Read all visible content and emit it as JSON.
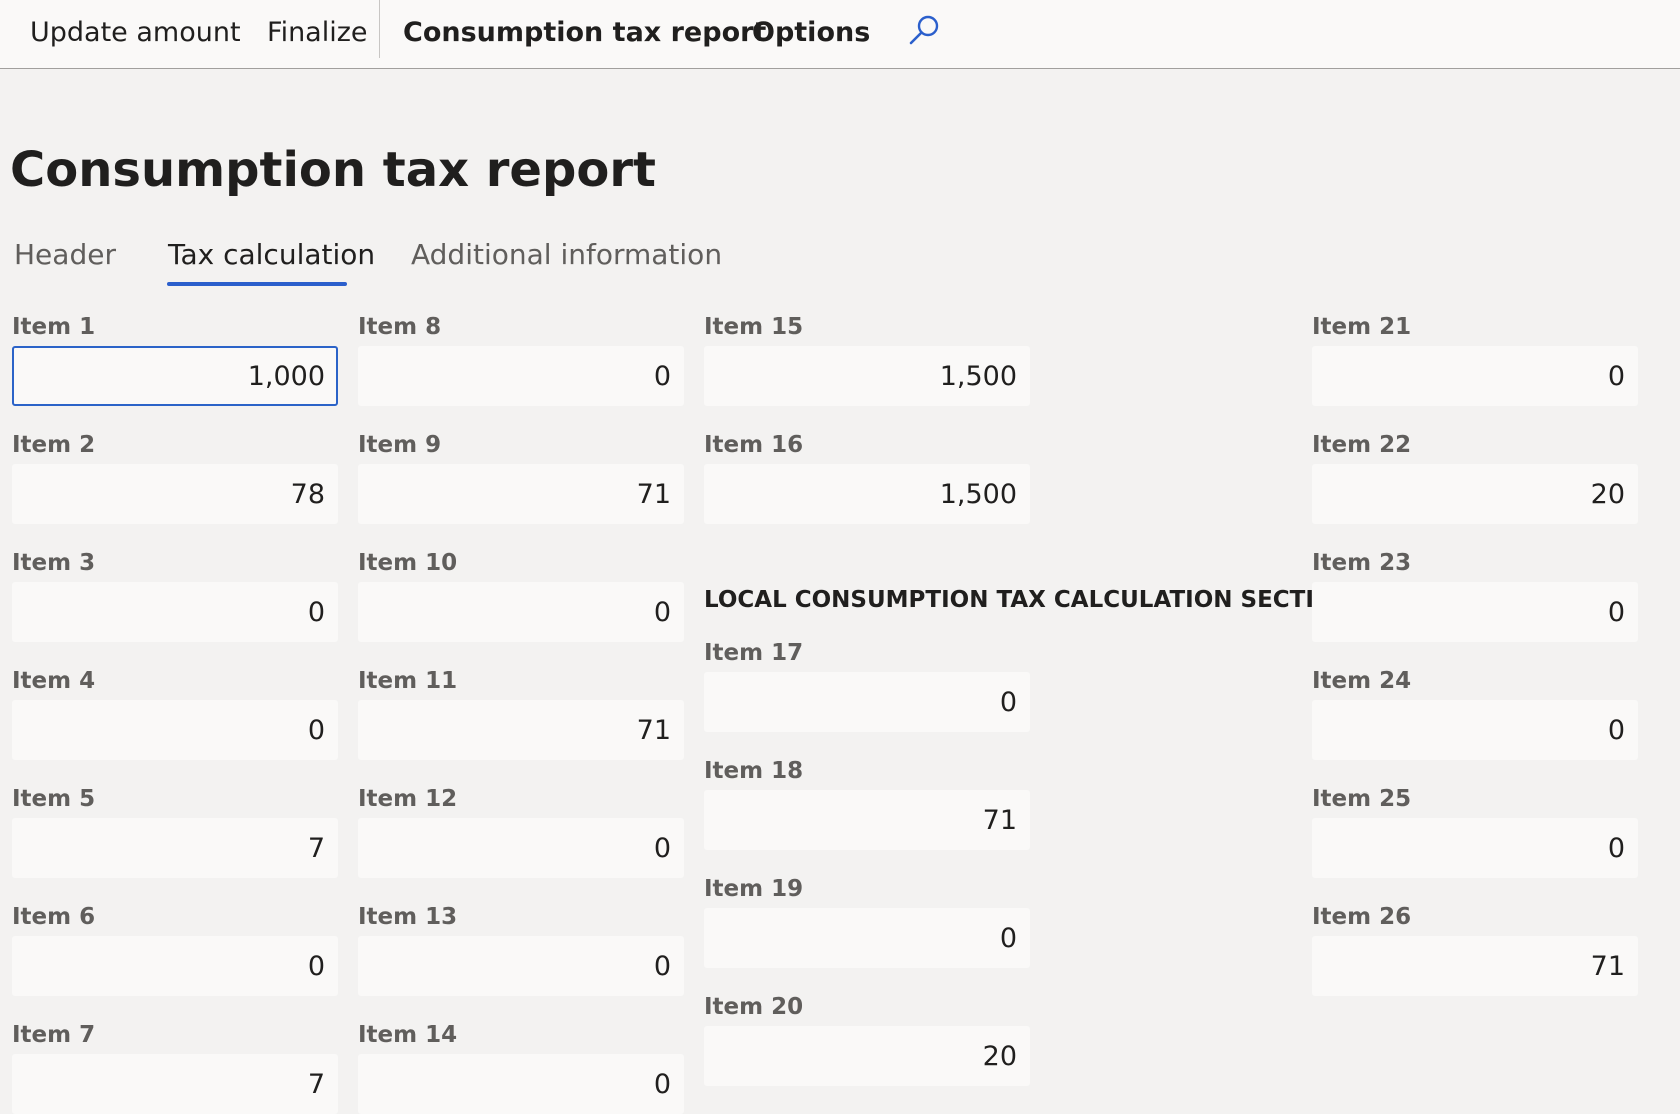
{
  "toolbar": {
    "update_amount": "Update amount",
    "finalize": "Finalize",
    "consumption_tax_report": "Consumption tax report",
    "options": "Options",
    "search_icon": "search-icon"
  },
  "page": {
    "title": "Consumption tax report"
  },
  "tabs": [
    {
      "label": "Header",
      "active": false
    },
    {
      "label": "Tax calculation",
      "active": true
    },
    {
      "label": "Additional information",
      "active": false
    }
  ],
  "section_heading": "LOCAL CONSUMPTION TAX CALCULATION SECTION",
  "items": [
    {
      "label": "Item 1",
      "value": "1,000",
      "focused": true
    },
    {
      "label": "Item 2",
      "value": "78"
    },
    {
      "label": "Item 3",
      "value": "0"
    },
    {
      "label": "Item 4",
      "value": "0"
    },
    {
      "label": "Item 5",
      "value": "7"
    },
    {
      "label": "Item 6",
      "value": "0"
    },
    {
      "label": "Item 7",
      "value": "7"
    },
    {
      "label": "Item 8",
      "value": "0"
    },
    {
      "label": "Item 9",
      "value": "71"
    },
    {
      "label": "Item 10",
      "value": "0"
    },
    {
      "label": "Item 11",
      "value": "71"
    },
    {
      "label": "Item 12",
      "value": "0"
    },
    {
      "label": "Item 13",
      "value": "0"
    },
    {
      "label": "Item 14",
      "value": "0"
    },
    {
      "label": "Item 15",
      "value": "1,500"
    },
    {
      "label": "Item 16",
      "value": "1,500"
    },
    {
      "label": "Item 17",
      "value": "0"
    },
    {
      "label": "Item 18",
      "value": "71"
    },
    {
      "label": "Item 19",
      "value": "0"
    },
    {
      "label": "Item 20",
      "value": "20"
    },
    {
      "label": "Item 21",
      "value": "0"
    },
    {
      "label": "Item 22",
      "value": "20"
    },
    {
      "label": "Item 23",
      "value": "0"
    },
    {
      "label": "Item 24",
      "value": "0"
    },
    {
      "label": "Item 25",
      "value": "0"
    },
    {
      "label": "Item 26",
      "value": "71"
    }
  ],
  "colors": {
    "accent": "#2b5fcc",
    "background": "#f3f2f1",
    "field_background": "#faf9f8"
  }
}
